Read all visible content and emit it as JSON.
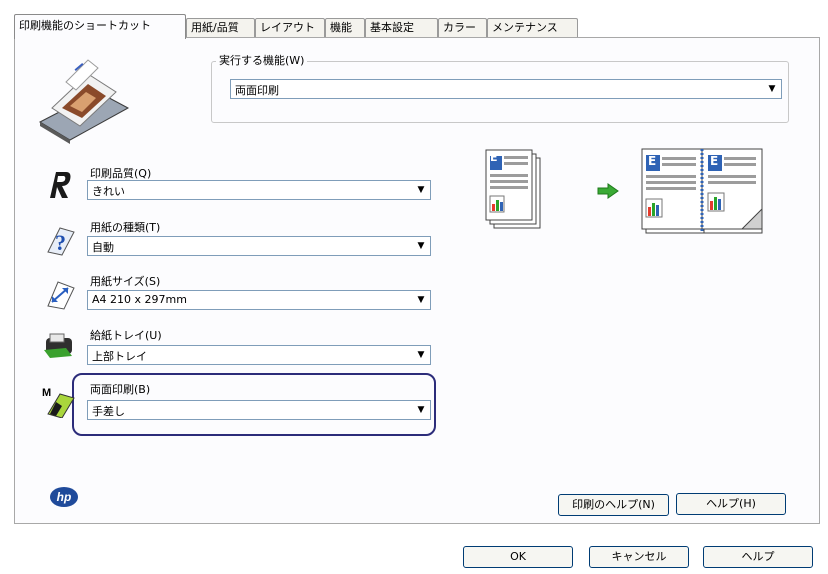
{
  "tabs": [
    {
      "label": "印刷機能のショートカット",
      "active": true
    },
    {
      "label": "用紙/品質",
      "active": false
    },
    {
      "label": "レイアウト",
      "active": false
    },
    {
      "label": "機能",
      "active": false
    },
    {
      "label": "基本設定",
      "active": false
    },
    {
      "label": "カラー",
      "active": false
    },
    {
      "label": "メンテナンス",
      "active": false
    }
  ],
  "task": {
    "label": "実行する機能(W)",
    "value": "両面印刷"
  },
  "fields": [
    {
      "key": "quality",
      "label": "印刷品質(Q)",
      "value": "きれい",
      "icon": "print-quality-icon"
    },
    {
      "key": "paper_type",
      "label": "用紙の種類(T)",
      "value": "自動",
      "icon": "paper-type-help-icon"
    },
    {
      "key": "paper_size",
      "label": "用紙サイズ(S)",
      "value": "A4 210 x 297mm",
      "icon": "paper-size-icon"
    },
    {
      "key": "tray",
      "label": "給紙トレイ(U)",
      "value": "上部トレイ",
      "icon": "paper-tray-icon"
    },
    {
      "key": "duplex",
      "label": "両面印刷(B)",
      "value": "手差し",
      "icon": "duplex-icon"
    }
  ],
  "preview": {
    "letter": "E"
  },
  "colors": {
    "accent": "#2c2c7a",
    "arrow": "#3aaa35",
    "border": "#7f9db9"
  },
  "buttons": {
    "print_help": "印刷のヘルプ(N)",
    "help_panel": "ヘルプ(H)",
    "ok": "OK",
    "cancel": "キャンセル",
    "help_dialog": "ヘルプ"
  },
  "logo": {
    "text": "hp"
  }
}
